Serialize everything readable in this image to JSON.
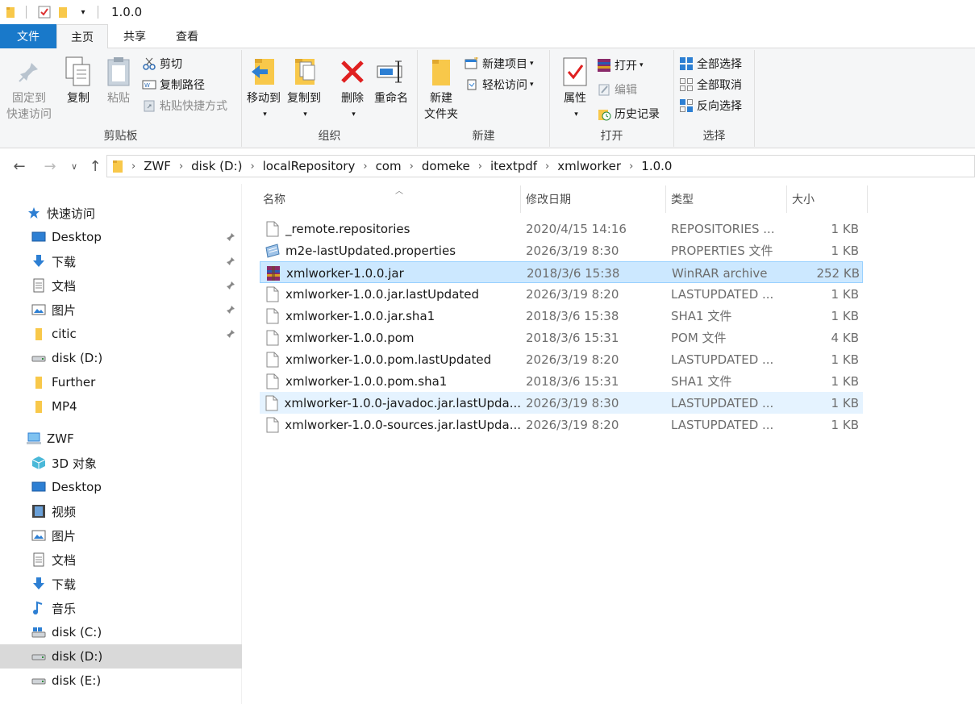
{
  "window": {
    "title": "1.0.0"
  },
  "ribbon_tabs": {
    "file": "文件",
    "home": "主页",
    "share": "共享",
    "view": "查看"
  },
  "ribbon": {
    "clipboard": {
      "label": "剪贴板",
      "pin_line1": "固定到",
      "pin_line2": "快速访问",
      "copy": "复制",
      "paste": "粘贴",
      "cut": "剪切",
      "copy_path": "复制路径",
      "paste_shortcut": "粘贴快捷方式"
    },
    "organize": {
      "label": "组织",
      "move_to": "移动到",
      "copy_to": "复制到",
      "delete": "删除",
      "rename": "重命名"
    },
    "new": {
      "label": "新建",
      "new_folder_line1": "新建",
      "new_folder_line2": "文件夹",
      "new_item": "新建项目",
      "easy_access": "轻松访问"
    },
    "open": {
      "label": "打开",
      "properties": "属性",
      "open": "打开",
      "edit": "编辑",
      "history": "历史记录"
    },
    "select": {
      "label": "选择",
      "select_all": "全部选择",
      "select_none": "全部取消",
      "invert": "反向选择"
    }
  },
  "address": {
    "crumbs": [
      "ZWF",
      "disk (D:)",
      "localRepository",
      "com",
      "domeke",
      "itextpdf",
      "xmlworker",
      "1.0.0"
    ]
  },
  "tree": {
    "quick_access": "快速访问",
    "quick_items": [
      "Desktop",
      "下载",
      "文档",
      "图片",
      "citic",
      "disk (D:)",
      "Further",
      "MP4"
    ],
    "this_pc": "ZWF",
    "pc_items": [
      "3D 对象",
      "Desktop",
      "视频",
      "图片",
      "文档",
      "下载",
      "音乐",
      "disk (C:)",
      "disk (D:)",
      "disk (E:)"
    ]
  },
  "columns": {
    "name": "名称",
    "date": "修改日期",
    "type": "类型",
    "size": "大小"
  },
  "files": [
    {
      "name": "_remote.repositories",
      "date": "2020/4/15 14:16",
      "type": "REPOSITORIES ...",
      "size": "1 KB",
      "icon": "blank-file-icon"
    },
    {
      "name": "m2e-lastUpdated.properties",
      "date": "2026/3/19 8:30",
      "type": "PROPERTIES 文件",
      "size": "1 KB",
      "icon": "properties-file-icon"
    },
    {
      "name": "xmlworker-1.0.0.jar",
      "date": "2018/3/6 15:38",
      "type": "WinRAR archive",
      "size": "252 KB",
      "icon": "winrar-archive-icon"
    },
    {
      "name": "xmlworker-1.0.0.jar.lastUpdated",
      "date": "2026/3/19 8:20",
      "type": "LASTUPDATED ...",
      "size": "1 KB",
      "icon": "blank-file-icon"
    },
    {
      "name": "xmlworker-1.0.0.jar.sha1",
      "date": "2018/3/6 15:38",
      "type": "SHA1 文件",
      "size": "1 KB",
      "icon": "blank-file-icon"
    },
    {
      "name": "xmlworker-1.0.0.pom",
      "date": "2018/3/6 15:31",
      "type": "POM 文件",
      "size": "4 KB",
      "icon": "blank-file-icon"
    },
    {
      "name": "xmlworker-1.0.0.pom.lastUpdated",
      "date": "2026/3/19 8:20",
      "type": "LASTUPDATED ...",
      "size": "1 KB",
      "icon": "blank-file-icon"
    },
    {
      "name": "xmlworker-1.0.0.pom.sha1",
      "date": "2018/3/6 15:31",
      "type": "SHA1 文件",
      "size": "1 KB",
      "icon": "blank-file-icon"
    },
    {
      "name": "xmlworker-1.0.0-javadoc.jar.lastUpda...",
      "date": "2026/3/19 8:30",
      "type": "LASTUPDATED ...",
      "size": "1 KB",
      "icon": "blank-file-icon"
    },
    {
      "name": "xmlworker-1.0.0-sources.jar.lastUpda...",
      "date": "2026/3/19 8:20",
      "type": "LASTUPDATED ...",
      "size": "1 KB",
      "icon": "blank-file-icon"
    }
  ],
  "selected_index": 2,
  "hover_index": 8,
  "colors": {
    "accent": "#1979ca",
    "selection": "#cce8ff",
    "folder": "#f8c84a"
  }
}
